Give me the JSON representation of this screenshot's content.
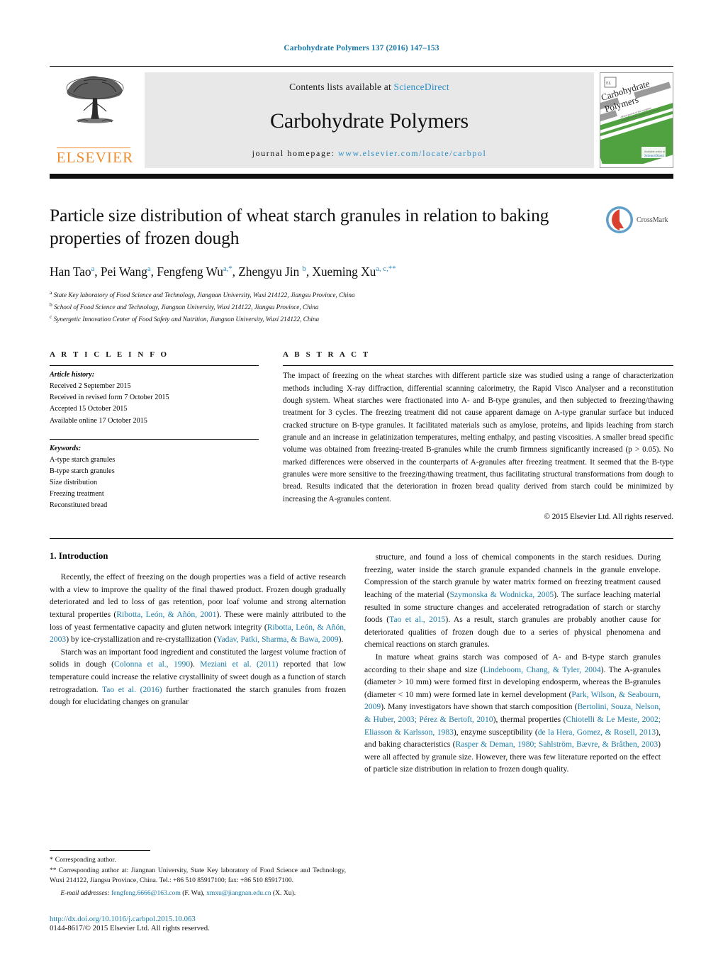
{
  "running_head": "Carbohydrate Polymers 137 (2016) 147–153",
  "masthead": {
    "publisher": "ELSEVIER",
    "contents_prefix": "Contents lists available at ",
    "contents_link": "ScienceDirect",
    "journal_name": "Carbohydrate Polymers",
    "homepage_prefix": "journal homepage: ",
    "homepage_url": "www.elsevier.com/locate/carbpol",
    "cover_title_line1": "Carbohydrate",
    "cover_title_line2": "Polymers",
    "cover_footer": "ScienceDirect"
  },
  "article": {
    "title": "Particle size distribution of wheat starch granules in relation to baking properties of frozen dough",
    "crossmark_label": "CrossMark",
    "authors_html": "Han Tao<sup>a</sup>, Pei Wang<sup>a</sup>, Fengfeng Wu<sup>a,</sup><sup>*</sup>, Zhengyu Jin <sup>b</sup>, Xueming Xu<sup>a, c,</sup><sup>**</sup>",
    "affiliations": [
      {
        "marker": "a",
        "text": "State Key laboratory of Food Science and Technology, Jiangnan University, Wuxi 214122, Jiangsu Province, China"
      },
      {
        "marker": "b",
        "text": "School of Food Science and Technology, Jiangnan University, Wuxi 214122, Jiangsu Province, China"
      },
      {
        "marker": "c",
        "text": "Synergetic Innovation Center of Food Safety and Nutrition, Jiangnan University, Wuxi 214122, China"
      }
    ]
  },
  "article_info": {
    "heading": "A R T I C L E   I N F O",
    "history_label": "Article history:",
    "history": [
      "Received 2 September 2015",
      "Received in revised form 7 October 2015",
      "Accepted 15 October 2015",
      "Available online 17 October 2015"
    ],
    "keywords_label": "Keywords:",
    "keywords": [
      "A-type starch granules",
      "B-type starch granules",
      "Size distribution",
      "Freezing treatment",
      "Reconstituted bread"
    ]
  },
  "abstract": {
    "heading": "A B S T R A C T",
    "text": "The impact of freezing on the wheat starches with different particle size was studied using a range of characterization methods including X-ray diffraction, differential scanning calorimetry, the Rapid Visco Analyser and a reconstitution dough system. Wheat starches were fractionated into A- and B-type granules, and then subjected to freezing/thawing treatment for 3 cycles. The freezing treatment did not cause apparent damage on A-type granular surface but induced cracked structure on B-type granules. It facilitated materials such as amylose, proteins, and lipids leaching from starch granule and an increase in gelatinization temperatures, melting enthalpy, and pasting viscosities. A smaller bread specific volume was obtained from freezing-treated B-granules while the crumb firmness significantly increased (p > 0.05). No marked differences were observed in the counterparts of A-granules after freezing treatment. It seemed that the B-type granules were more sensitive to the freezing/thawing treatment, thus facilitating structural transformations from dough to bread. Results indicated that the deterioration in frozen bread quality derived from starch could be minimized by increasing the A-granules content.",
    "copyright": "© 2015 Elsevier Ltd. All rights reserved."
  },
  "introduction": {
    "heading": "1.  Introduction",
    "left_paragraphs": [
      "Recently, the effect of freezing on the dough properties was a field of active research with a view to improve the quality of the final thawed product. Frozen dough gradually deteriorated and led to loss of gas retention, poor loaf volume and strong alternation textural properties (Ribotta, León, & Añón, 2001). These were mainly attributed to the loss of yeast fermentative capacity and gluten network integrity (Ribotta, León, & Añón, 2003) by ice-crystallization and re-crystallization (Yadav, Patki, Sharma, & Bawa, 2009).",
      "Starch was an important food ingredient and constituted the largest volume fraction of solids in dough (Colonna et al., 1990). Meziani et al. (2011) reported that low temperature could increase the relative crystallinity of sweet dough as a function of starch retrogradation. Tao et al. (2016) further fractionated the starch granules from frozen dough for elucidating changes on granular"
    ],
    "right_paragraphs": [
      "structure, and found a loss of chemical components in the starch residues. During freezing, water inside the starch granule expanded channels in the granule envelope. Compression of the starch granule by water matrix formed on freezing treatment caused leaching of the material (Szymonska & Wodnicka, 2005). The surface leaching material resulted in some structure changes and accelerated retrogradation of starch or starchy foods (Tao et al., 2015). As a result, starch granules are probably another cause for deteriorated qualities of frozen dough due to a series of physical phenomena and chemical reactions on starch granules.",
      "In mature wheat grains starch was composed of A- and B-type starch granules according to their shape and size (Lindeboom, Chang, & Tyler, 2004). The A-granules (diameter > 10 mm) were formed first in developing endosperm, whereas the B-granules (diameter < 10 mm) were formed late in kernel development (Park, Wilson, & Seabourn, 2009). Many investigators have shown that starch composition (Bertolini, Souza, Nelson, & Huber, 2003; Pérez & Bertoft, 2010), thermal properties (Chiotelli & Le Meste, 2002; Eliasson & Karlsson, 1983), enzyme susceptibility (de la Hera, Gomez, & Rosell, 2013), and baking characteristics (Rasper & Deman, 1980; Sahlström, Bævre, & Bråthen, 2003) were all affected by granule size. However, there was few literature reported on the effect of particle size distribution in relation to frozen dough quality."
    ]
  },
  "footnotes": {
    "star_single": "*",
    "star_single_text": "Corresponding author.",
    "star_double": "**",
    "star_double_text": "Corresponding author at: Jiangnan University, State Key laboratory of Food Science and Technology, Wuxi 214122, Jiangsu Province, China. Tel.: +86 510 85917100; fax: +86 510 85917100.",
    "email_label": "E-mail addresses:",
    "email_1": "fengfeng.6666@163.com",
    "email_1_owner": "(F. Wu),",
    "email_2": "xmxu@jiangnan.edu.cn",
    "email_2_owner": "(X. Xu)."
  },
  "bottom": {
    "doi": "http://dx.doi.org/10.1016/j.carbpol.2015.10.063",
    "issn_line": "0144-8617/© 2015 Elsevier Ltd. All rights reserved."
  },
  "colors": {
    "link_blue": "#1a7aa8",
    "sciencedirect_blue": "#2a8cc4",
    "elsevier_orange": "#f08c2e",
    "band_grey": "#e8e8e8",
    "crossmark_red": "#d8402f",
    "cover_green": "#4fa23f"
  }
}
